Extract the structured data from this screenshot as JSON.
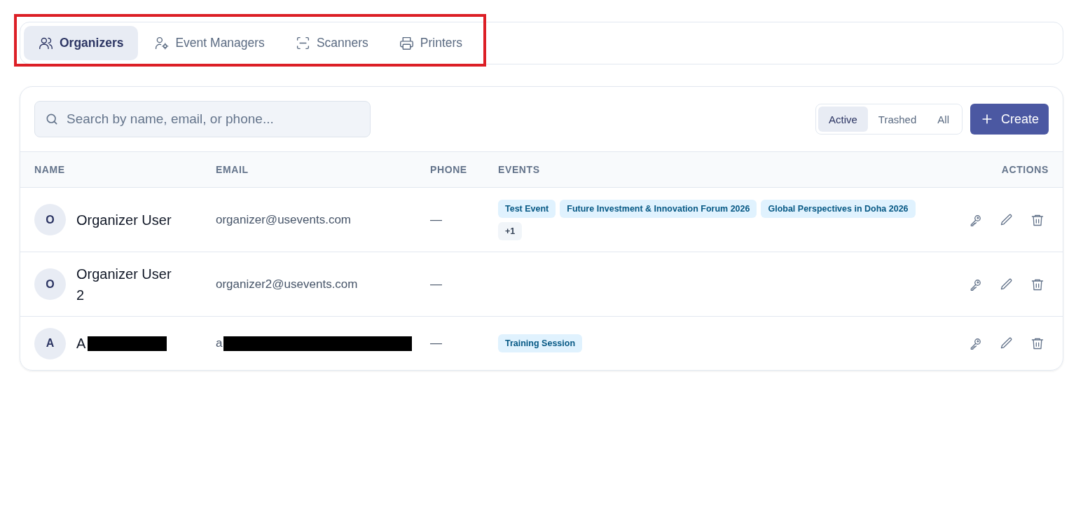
{
  "tabs_bar": {
    "highlighted": true,
    "tabs": [
      {
        "label": "Organizers",
        "selected": true
      },
      {
        "label": "Event Managers",
        "selected": false
      },
      {
        "label": "Scanners",
        "selected": false
      },
      {
        "label": "Printers",
        "selected": false
      }
    ]
  },
  "search": {
    "placeholder": "Search by name, email, or phone..."
  },
  "filters": [
    {
      "label": "Active",
      "selected": true
    },
    {
      "label": "Trashed",
      "selected": false
    },
    {
      "label": "All",
      "selected": false
    }
  ],
  "create_button": {
    "label": "Create"
  },
  "table": {
    "columns": [
      "NAME",
      "EMAIL",
      "PHONE",
      "EVENTS",
      "ACTIONS"
    ],
    "rows": [
      {
        "initial": "O",
        "name": "Organizer User",
        "name_redacted": false,
        "email": "organizer@usevents.com",
        "email_redacted": false,
        "phone": "—",
        "events": [
          {
            "label": "Test Event",
            "kind": "event"
          },
          {
            "label": "Future Investment & Innovation Forum 2026",
            "kind": "event"
          },
          {
            "label": "Global Perspectives in Doha 2026",
            "kind": "event"
          },
          {
            "label": "+1",
            "kind": "more"
          }
        ]
      },
      {
        "initial": "O",
        "name": "Organizer User 2",
        "name_redacted": false,
        "email": "organizer2@usevents.com",
        "email_redacted": false,
        "phone": "—",
        "events": []
      },
      {
        "initial": "A",
        "name": "A",
        "name_redacted": true,
        "email": "a",
        "email_redacted": true,
        "phone": "—",
        "events": [
          {
            "label": "Training Session",
            "kind": "event"
          }
        ]
      }
    ]
  }
}
